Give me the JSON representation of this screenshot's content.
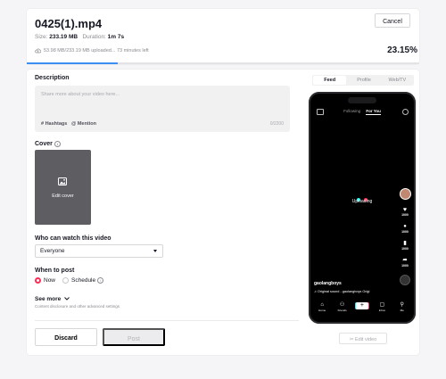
{
  "header": {
    "file_name": "0425(1).mp4",
    "size_label": "Size:",
    "size_value": "233.19 MB",
    "duration_label": "Duration:",
    "duration_value": "1m 7s",
    "upload_status": "53.98 MB/233.19 MB uploaded... 73 minutes left",
    "percent": "23.15%",
    "progress_fraction": 0.2315,
    "cancel_label": "Cancel"
  },
  "form": {
    "description_label": "Description",
    "description_placeholder": "Share more about your video here...",
    "hashtags_label": "# Hashtags",
    "mention_label": "@ Mention",
    "char_counter": "0/2200",
    "cover_label": "Cover",
    "edit_cover_label": "Edit cover",
    "who_can_watch_label": "Who can watch this video",
    "who_can_watch_value": "Everyone",
    "when_to_post_label": "When to post",
    "option_now": "Now",
    "option_schedule": "Schedule",
    "see_more_label": "See more",
    "see_more_sub": "Content disclosure and other advanced settings",
    "discard_label": "Discard",
    "post_label": "Post"
  },
  "preview": {
    "tabs": [
      {
        "label": "Feed",
        "active": true
      },
      {
        "label": "Profile",
        "active": false
      },
      {
        "label": "Web/TV",
        "active": false
      }
    ],
    "following_label": "Following",
    "for_you_label": "For You",
    "uploading_label": "Uploading",
    "rail_counts": [
      "1000",
      "1000",
      "1000",
      "1000"
    ],
    "username": "gaolangboys",
    "sound_text": "Original sound - gaolangboys  Origi",
    "nav": [
      "Home",
      "Friends",
      "",
      "Inbox",
      "Me"
    ],
    "edit_video_label": "Edit video",
    "accent_colors": {
      "cyan": "#25f4ee",
      "red": "#fe2c55"
    }
  }
}
